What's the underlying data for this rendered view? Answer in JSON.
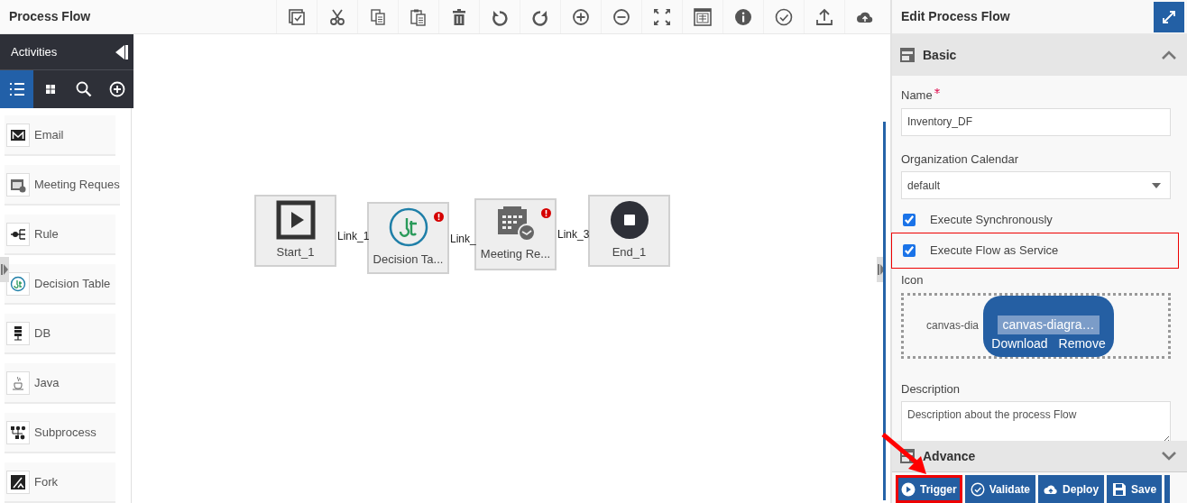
{
  "title": "Process Flow",
  "toolbar": [
    {
      "kind": "select"
    },
    {
      "kind": "cut"
    },
    {
      "kind": "copy"
    },
    {
      "kind": "paste"
    },
    {
      "kind": "delete"
    },
    {
      "kind": "undo"
    },
    {
      "kind": "redo"
    },
    {
      "kind": "zoom_in"
    },
    {
      "kind": "zoom_out"
    },
    {
      "kind": "fit"
    },
    {
      "kind": "overview"
    },
    {
      "kind": "info"
    },
    {
      "kind": "check"
    },
    {
      "kind": "upload"
    },
    {
      "kind": "cloud"
    }
  ],
  "activities": {
    "title": "Activities",
    "tabs": [
      {
        "kind": "list",
        "selected": true
      },
      {
        "kind": "grid",
        "selected": false
      },
      {
        "kind": "search",
        "selected": false
      },
      {
        "kind": "add",
        "selected": false
      }
    ],
    "items": [
      {
        "label": "Email",
        "kind": "email"
      },
      {
        "label": "Meeting Reques",
        "kind": "meeting"
      },
      {
        "label": "Rule",
        "kind": "rule"
      },
      {
        "label": "Decision Table",
        "kind": "decision"
      },
      {
        "label": "DB",
        "kind": "db"
      },
      {
        "label": "Java",
        "kind": "java"
      },
      {
        "label": "Subprocess",
        "kind": "subprocess"
      },
      {
        "label": "Fork",
        "kind": "fork"
      }
    ]
  },
  "canvas": {
    "nodes": [
      {
        "label": "Start_1",
        "kind": "start",
        "warning": false
      },
      {
        "label": "Decision Ta...",
        "kind": "decision",
        "warning": true
      },
      {
        "label": "Meeting Re...",
        "kind": "meeting",
        "warning": true
      },
      {
        "label": "End_1",
        "kind": "end",
        "warning": false
      }
    ],
    "links": [
      "Link_1",
      "Link_",
      "Link_3"
    ]
  },
  "panel": {
    "title": "Edit Process Flow",
    "basic": {
      "title": "Basic",
      "expanded": true
    },
    "name": {
      "label": "Name",
      "required": true,
      "value": "Inventory_DF"
    },
    "calendar": {
      "label": "Organization Calendar",
      "value": "default"
    },
    "options": [
      {
        "label": "Execute Synchronously",
        "checked": true,
        "highlighted": false
      },
      {
        "label": "Execute Flow as Service",
        "checked": true,
        "highlighted": true
      }
    ],
    "icon": {
      "label": "Icon",
      "file_text": "canvas-dia",
      "file_name": "canvas-diagra…",
      "actions": [
        "Download",
        "Remove"
      ]
    },
    "description": {
      "label": "Description",
      "value": "Description about the process Flow"
    },
    "advance": {
      "title": "Advance",
      "expanded": false
    },
    "buttons": [
      {
        "label": "Trigger",
        "kind": "trigger",
        "highlighted": true
      },
      {
        "label": "Validate",
        "kind": "validate",
        "highlighted": false
      },
      {
        "label": "Deploy",
        "kind": "deploy",
        "highlighted": false
      },
      {
        "label": "Save",
        "kind": "save",
        "highlighted": false
      }
    ]
  }
}
